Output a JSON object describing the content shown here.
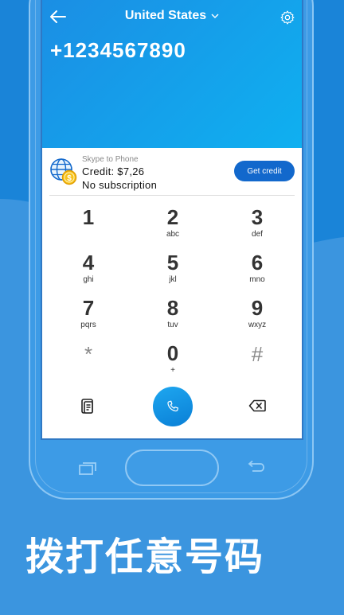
{
  "header": {
    "country": "United States",
    "number": "+1234567890"
  },
  "credit": {
    "product": "Skype to Phone",
    "balance": "Credit: $7,26",
    "subscription": "No subscription",
    "button_label": "Get credit"
  },
  "keypad": {
    "keys": [
      {
        "main": "1",
        "sub": ""
      },
      {
        "main": "2",
        "sub": "abc"
      },
      {
        "main": "3",
        "sub": "def"
      },
      {
        "main": "4",
        "sub": "ghi"
      },
      {
        "main": "5",
        "sub": "jkl"
      },
      {
        "main": "6",
        "sub": "mno"
      },
      {
        "main": "7",
        "sub": "pqrs"
      },
      {
        "main": "8",
        "sub": "tuv"
      },
      {
        "main": "9",
        "sub": "wxyz"
      },
      {
        "main": "*",
        "sub": ""
      },
      {
        "main": "0",
        "sub": "+"
      },
      {
        "main": "#",
        "sub": ""
      }
    ]
  },
  "icons": {
    "back": "arrow-left-icon",
    "dropdown": "chevron-down-icon",
    "settings": "gear-icon",
    "credit": "globe-coin-icon",
    "dialpad": "dialpad-icon",
    "call": "phone-icon",
    "backspace": "backspace-icon"
  },
  "colors": {
    "accent": "#1268cc",
    "header_start": "#1b8ee4",
    "header_end": "#0fb0f0",
    "background": "#1a84d8"
  },
  "caption": "拨打任意号码"
}
